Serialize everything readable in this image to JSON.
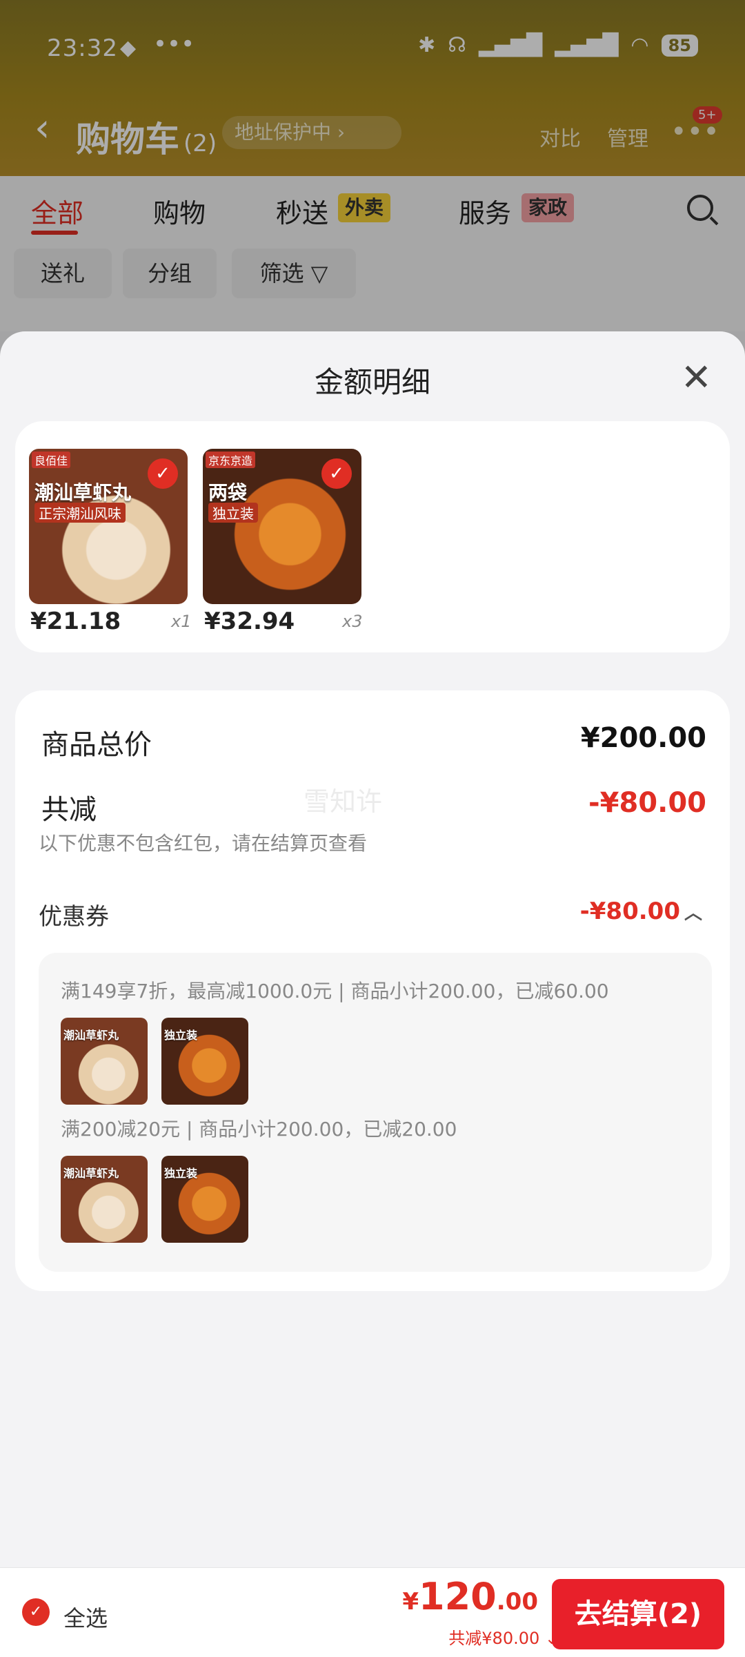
{
  "status": {
    "time": "23:32",
    "dots": "•••",
    "battery": "85"
  },
  "header": {
    "back": "‹",
    "title": "购物车",
    "count": "(2)",
    "addr": "地址保护中 ›",
    "compare": "对比",
    "manage": "管理",
    "more": "•••",
    "badge": "5+"
  },
  "tabs": [
    {
      "label": "全部"
    },
    {
      "label": "购物"
    },
    {
      "label": "秒送",
      "tag": "外卖"
    },
    {
      "label": "服务",
      "tag": "家政"
    }
  ],
  "chips": [
    "送礼",
    "分组",
    "筛选 ▽"
  ],
  "sheet": {
    "title": "金额明细",
    "close": "✕",
    "products": [
      {
        "name": "潮汕草虾丸",
        "sub": "正宗潮汕风味",
        "brand": "良佰佳",
        "price": "¥21.18",
        "qty": "x1"
      },
      {
        "name": "两袋",
        "sub": "独立装",
        "brand": "京东京造",
        "price": "¥32.94",
        "qty": "x3"
      }
    ],
    "summary": {
      "total_label": "商品总价",
      "total_value": "¥200.00",
      "discount_label": "共减",
      "discount_value": "-¥80.00",
      "note": "以下优惠不包含红包，请在结算页查看",
      "coupon_label": "优惠券",
      "coupon_value": "-¥80.00",
      "rules": [
        "满149享7折，最高减1000.0元 | 商品小计200.00，已减60.00",
        "满200减20元 | 商品小计200.00，已减20.00"
      ]
    },
    "watermark": "雪知许"
  },
  "bottom": {
    "select_all": "全选",
    "yen": "¥",
    "total_int": "120",
    "total_dec": ".00",
    "saved": "共减¥80.00 ⌄",
    "checkout": "去结算(2)"
  },
  "colors": {
    "accent": "#e02e24",
    "header": "#a88a1e"
  }
}
